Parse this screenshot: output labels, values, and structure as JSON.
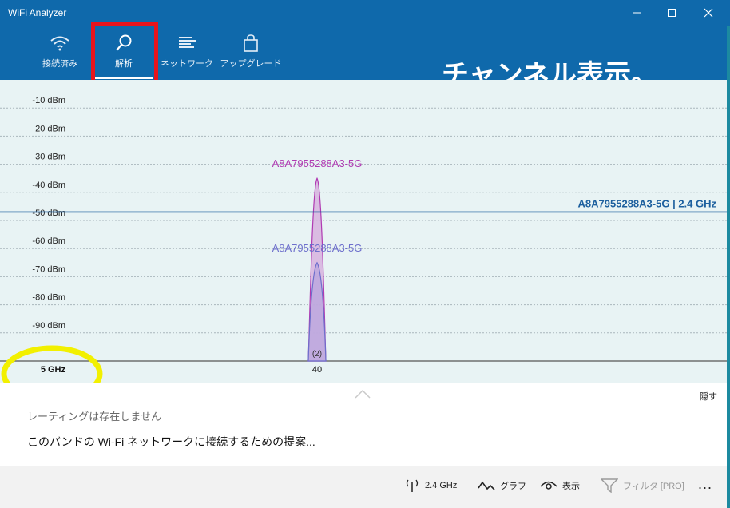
{
  "window": {
    "title": "WiFi Analyzer"
  },
  "nav": {
    "items": [
      {
        "label": "接続済み",
        "icon": "wifi-icon"
      },
      {
        "label": "解析",
        "icon": "analyze-icon",
        "selected": true
      },
      {
        "label": "ネットワーク",
        "icon": "network-list-icon"
      },
      {
        "label": "アップグレード",
        "icon": "shopping-bag-icon"
      }
    ]
  },
  "overlay_caption": "チャンネル表示。",
  "chart_data": {
    "type": "area",
    "y_ticks": [
      "-10 dBm",
      "-20 dBm",
      "-30 dBm",
      "-40 dBm",
      "-50 dBm",
      "-60 dBm",
      "-70 dBm",
      "-80 dBm",
      "-90 dBm"
    ],
    "ylim": [
      -100,
      0
    ],
    "band_label": "5 GHz",
    "x_ticks": [
      "40"
    ],
    "reference_line": {
      "value": -47,
      "label": "A8A7955288A3-5G | 2.4 GHz"
    },
    "series": [
      {
        "name": "A8A7955288A3-5G",
        "channel": 40,
        "peak": -35,
        "color": "#b03ab2",
        "fill": "#d7b1de"
      },
      {
        "name": "A8A7955288A3-5G",
        "channel": 40,
        "peak": -65,
        "color": "#6d6fcc",
        "fill": "#b8a6de"
      }
    ],
    "count_label": "(2)"
  },
  "panel": {
    "hide_label": "隠す",
    "rating_text": "レーティングは存在しません",
    "suggestion_text": "このバンドの Wi-Fi ネットワークに接続するための提案..."
  },
  "bottom_bar": {
    "band": "2.4 GHz",
    "graph": "グラフ",
    "view": "表示",
    "filter": "フィルタ [PRO]",
    "more": "..."
  },
  "colors": {
    "header": "#0f69ab",
    "chart_bg": "#e8f3f4",
    "highlight_box": "#e8141c",
    "annotation_circle": "#f2f000"
  }
}
